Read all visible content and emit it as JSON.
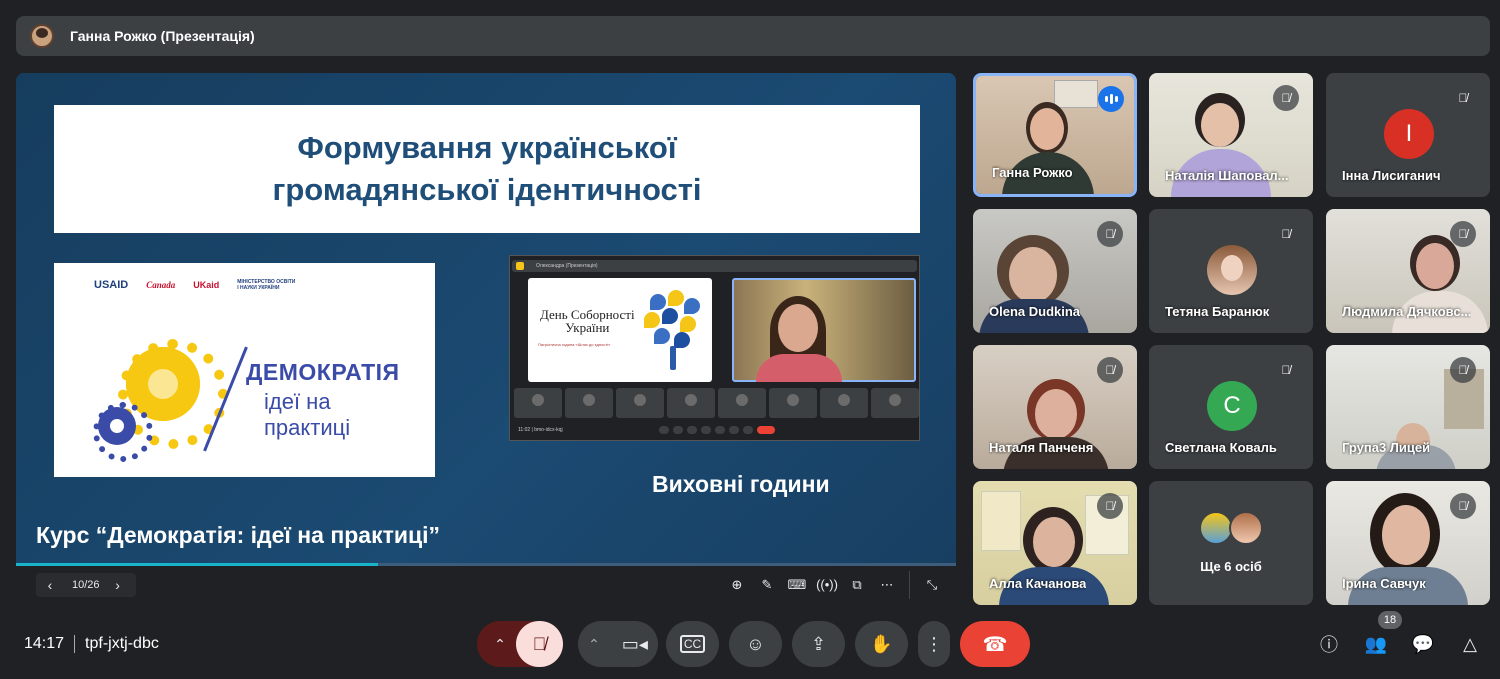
{
  "colors": {
    "bg": "#202124",
    "tile": "#3c4043",
    "accent": "#8ab4f8",
    "end_call": "#ea4335",
    "mic_off": "#f9dedc",
    "slide_bg": "#1b4a72"
  },
  "header": {
    "presenter_title": "Ганна Рожко (Презентація)"
  },
  "presentation": {
    "slide_title": "Формування української\nгромадянської ідентичності",
    "logos": [
      "USAID",
      "Canada",
      "UKaid",
      "МІНІСТЕРСТВО ОСВІТИ І НАУКИ УКРАЇНИ"
    ],
    "demo_title": "ДЕМОКРАТІЯ",
    "demo_sub": "ідеї на\nпрактиці",
    "inner_screenshot": {
      "bar_title": "Олександра (Презентація)",
      "slide_title": "День Соборності\nУкраїни",
      "slide_sub": "Патріотична година «Шлях до єдності»",
      "meeting_code": "11:02  |  bmo-idcx-kqj"
    },
    "caption_right": "Виховні години",
    "caption_bottom": "Курс “Демократія: ідеї на практиці”",
    "progress_percent": 38.5,
    "page_indicator": "10/26",
    "controls": {
      "prev_icon": "chevron-left-icon",
      "next_icon": "chevron-right-icon",
      "zoom_icon": "zoom-in-icon",
      "pen_icon": "pen-icon",
      "captions_icon": "keyboard-icon",
      "broadcast_icon": "broadcast-icon",
      "pip_icon": "pip-icon",
      "more_icon": "more-horiz-icon",
      "exit_icon": "collapse-icon"
    }
  },
  "participants": [
    {
      "name": "Ганна Рожко",
      "state": "speaking",
      "active": true
    },
    {
      "name": "Наталія Шаповал...",
      "state": "muted"
    },
    {
      "name": "Інна Лисиганич",
      "state": "muted",
      "initial": "І",
      "avatar_color": "#d93025"
    },
    {
      "name": "Olena Dudkina",
      "state": "muted"
    },
    {
      "name": "Тетяна Баранюк",
      "state": "muted"
    },
    {
      "name": "Людмила Дячковс...",
      "state": "muted"
    },
    {
      "name": "Наталя Панченя",
      "state": "muted"
    },
    {
      "name": "Светлана Коваль",
      "state": "muted",
      "initial": "C",
      "avatar_color": "#34a853"
    },
    {
      "name": "Група3 Лицей",
      "state": "muted"
    },
    {
      "name": "Алла Качанова",
      "state": "muted"
    },
    {
      "name": "Ще 6 осіб",
      "state": "more"
    },
    {
      "name": "Ірина Савчук",
      "state": "muted"
    }
  ],
  "bottom": {
    "time": "14:17",
    "meeting_code": "tpf-jxtj-dbc",
    "participant_count": "18"
  }
}
